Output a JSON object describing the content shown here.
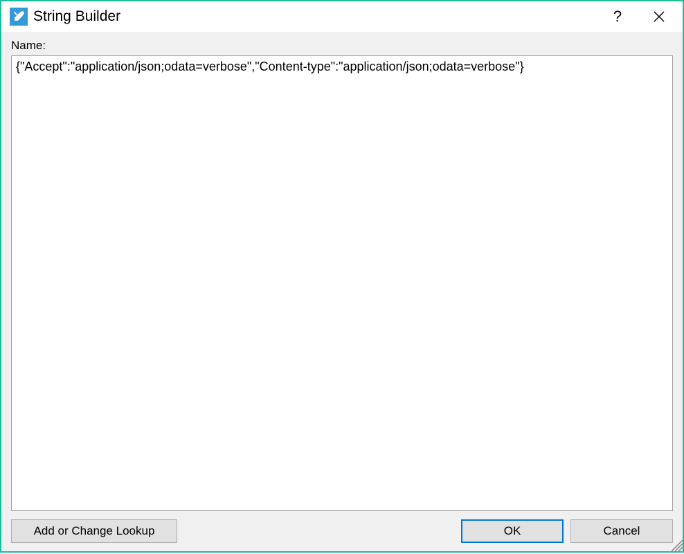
{
  "titlebar": {
    "title": "String Builder",
    "icon_name": "tools-icon"
  },
  "content": {
    "name_label": "Name:",
    "name_value": "{\"Accept\":\"application/json;odata=verbose\",\"Content-type\":\"application/json;odata=verbose\"}"
  },
  "buttons": {
    "lookup": "Add or Change Lookup",
    "ok": "OK",
    "cancel": "Cancel"
  }
}
